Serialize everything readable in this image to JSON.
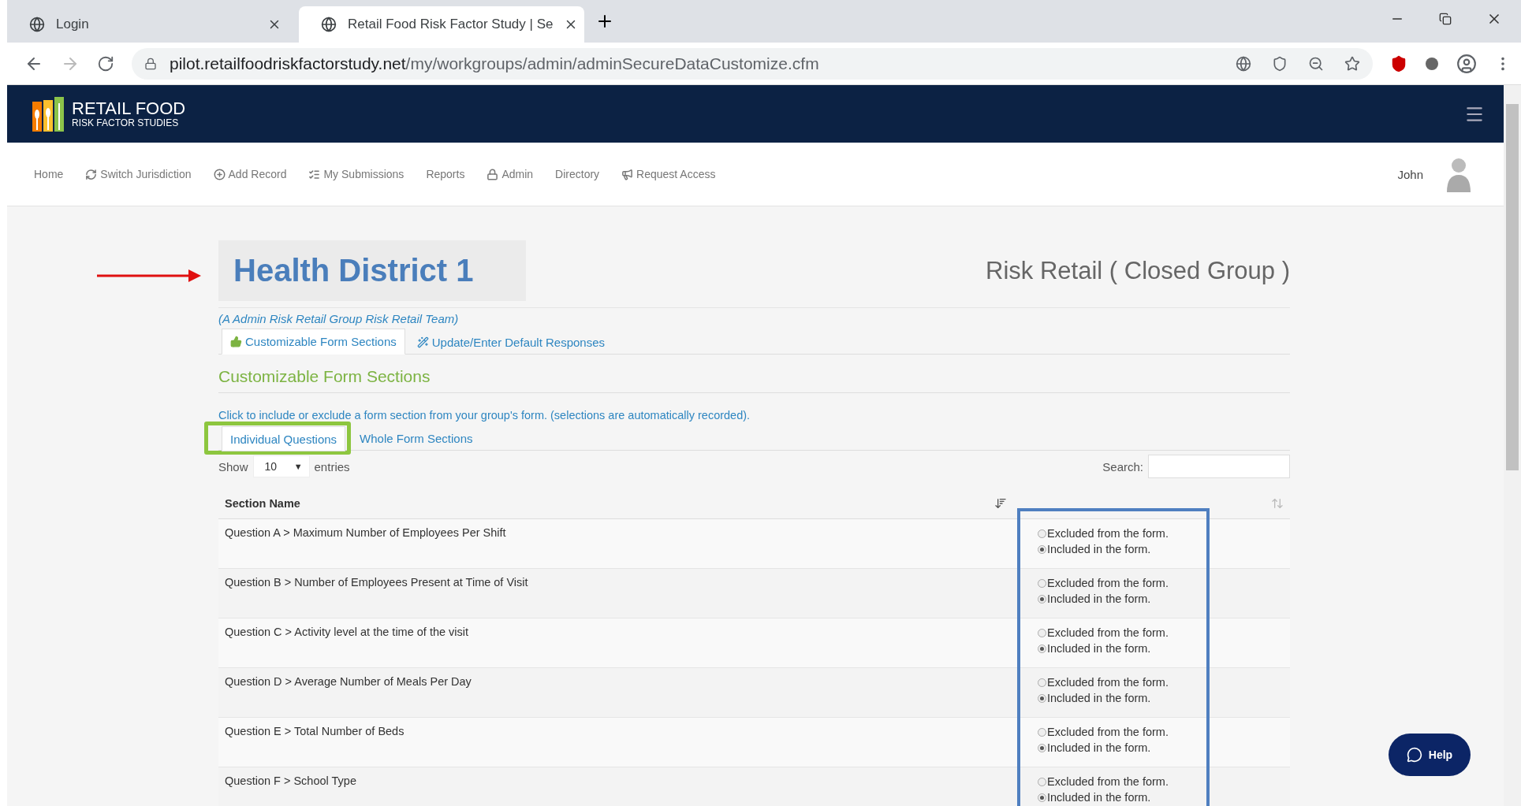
{
  "browser": {
    "tabs": [
      {
        "title": "Login",
        "selected": false
      },
      {
        "title": "Retail Food Risk Factor Study | Se",
        "selected": true
      }
    ],
    "url_host": "pilot.retailfoodriskfactorstudy.net",
    "url_path": "/my/workgroups/admin/adminSecureDataCustomize.cfm"
  },
  "site": {
    "logo_title": "RETAIL FOOD",
    "logo_subtitle": "RISK FACTOR STUDIES",
    "nav": [
      {
        "label": "Home",
        "kind": "plain"
      },
      {
        "label": "Switch Jurisdiction",
        "kind": "refresh"
      },
      {
        "label": "Add Record",
        "kind": "plus"
      },
      {
        "label": "My Submissions",
        "kind": "list"
      },
      {
        "label": "Reports",
        "kind": "plain"
      },
      {
        "label": "Admin",
        "kind": "lock"
      },
      {
        "label": "Directory",
        "kind": "plain"
      },
      {
        "label": "Request Access",
        "kind": "bullhorn"
      }
    ],
    "user": "John"
  },
  "page": {
    "title": "Health District 1",
    "group": "Risk Retail ( Closed Group )",
    "subtitle": "(A Admin Risk Retail Group Risk Retail Team)",
    "tabs": [
      {
        "label": "Customizable Form Sections",
        "kind": "thumb",
        "selected": true
      },
      {
        "label": "Update/Enter Default Responses",
        "kind": "wand",
        "selected": false
      }
    ],
    "heading": "Customizable Form Sections",
    "instructions": "Click to include or exclude a form section from your group's form. (selections are automatically recorded).",
    "subtabs": [
      {
        "label": "Individual Questions",
        "selected": true
      },
      {
        "label": "Whole Form Sections",
        "selected": false
      }
    ],
    "show_label": "Show",
    "page_size": "10",
    "page_size_caret": "▼",
    "entries_label": "entries",
    "search_label": "Search:",
    "column_1": "Section Name",
    "rows": [
      {
        "name": "Question A > Maximum Number of Employees Per Shift",
        "options": [
          {
            "label": "Excluded from the form.",
            "selected": false
          },
          {
            "label": "Included in the form.",
            "selected": true
          }
        ]
      },
      {
        "name": "Question B > Number of Employees Present at Time of Visit",
        "options": [
          {
            "label": "Excluded from the form.",
            "selected": false
          },
          {
            "label": "Included in the form.",
            "selected": true
          }
        ]
      },
      {
        "name": "Question C > Activity level at the time of the visit",
        "options": [
          {
            "label": "Excluded from the form.",
            "selected": false
          },
          {
            "label": "Included in the form.",
            "selected": true
          }
        ]
      },
      {
        "name": "Question D > Average Number of Meals Per Day",
        "options": [
          {
            "label": "Excluded from the form.",
            "selected": false
          },
          {
            "label": "Included in the form.",
            "selected": true
          }
        ]
      },
      {
        "name": "Question E > Total Number of Beds",
        "options": [
          {
            "label": "Excluded from the form.",
            "selected": false
          },
          {
            "label": "Included in the form.",
            "selected": true
          }
        ]
      },
      {
        "name": "Question F > School Type",
        "options": [
          {
            "label": "Excluded from the form.",
            "selected": false
          },
          {
            "label": "Included in the form.",
            "selected": true
          }
        ]
      }
    ]
  },
  "help": "Help"
}
